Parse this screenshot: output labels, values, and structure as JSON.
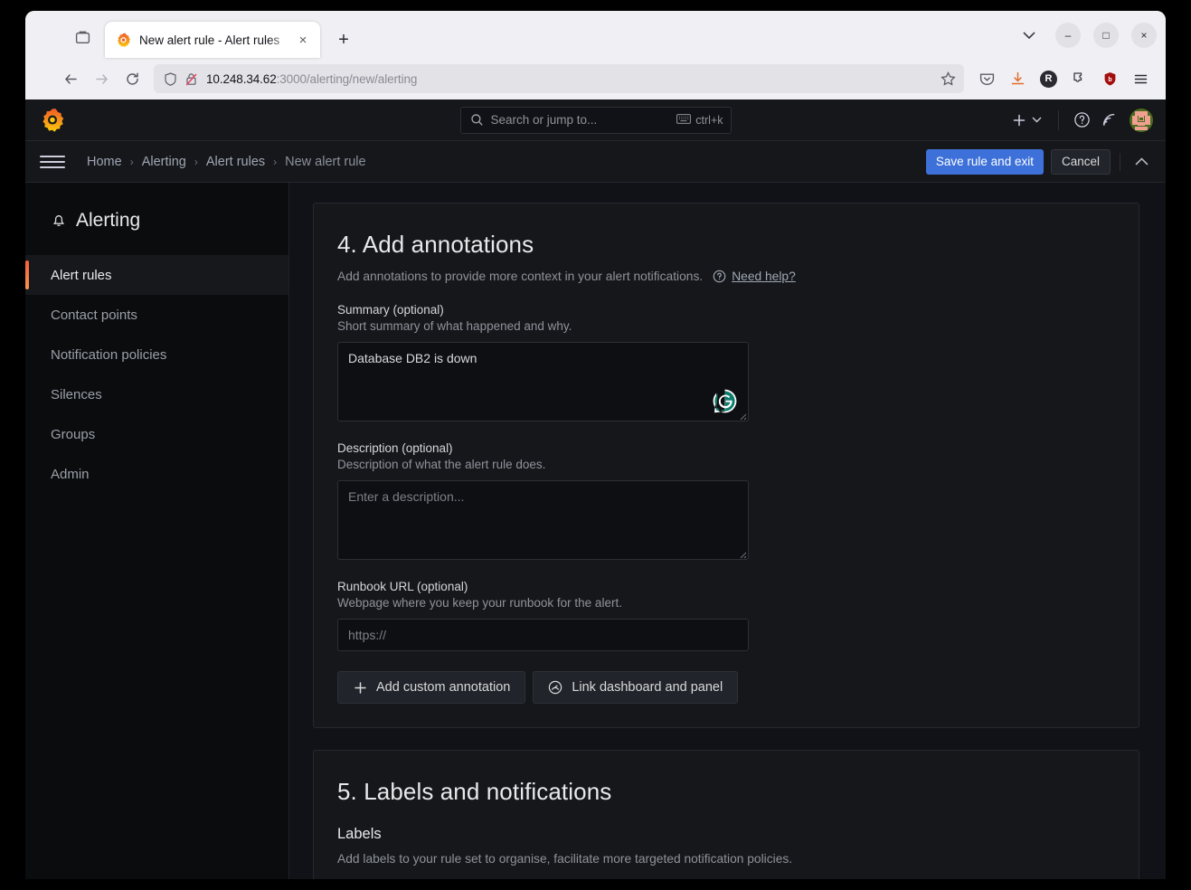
{
  "browser": {
    "tab": {
      "title": "New alert rule - Alert rules",
      "favicon": "grafana-icon",
      "close": "×"
    },
    "new_tab_label": "+",
    "url": {
      "host": "10.248.34.62",
      "rest": ":3000/alerting/new/alerting"
    },
    "toolbar_icons": [
      "pocket-icon",
      "download-icon",
      "account-avatar-icon",
      "extensions-icon",
      "ublock-shield-icon",
      "app-menu-icon"
    ],
    "window_controls": {
      "minimize": "–",
      "maximize": "□",
      "close": "×"
    }
  },
  "topnav": {
    "search": {
      "placeholder": "Search or jump to...",
      "shortcut": "ctrl+k"
    },
    "plus_label": "+",
    "icons": [
      "help-circle-icon",
      "news-feed-icon",
      "user-avatar"
    ]
  },
  "breadcrumb": {
    "items": [
      {
        "label": "Home",
        "current": false
      },
      {
        "label": "Alerting",
        "current": false
      },
      {
        "label": "Alert rules",
        "current": false
      },
      {
        "label": "New alert rule",
        "current": true
      }
    ],
    "separator": "›",
    "save_label": "Save rule and exit",
    "cancel_label": "Cancel"
  },
  "sidebar": {
    "title": "Alerting",
    "items": [
      {
        "label": "Alert rules",
        "active": true
      },
      {
        "label": "Contact points",
        "active": false
      },
      {
        "label": "Notification policies",
        "active": false
      },
      {
        "label": "Silences",
        "active": false
      },
      {
        "label": "Groups",
        "active": false
      },
      {
        "label": "Admin",
        "active": false
      }
    ]
  },
  "section4": {
    "heading": "4. Add annotations",
    "description": "Add annotations to provide more context in your alert notifications.",
    "need_help": "Need help?",
    "summary": {
      "label": "Summary (optional)",
      "sub": "Short summary of what happened and why.",
      "value": "Database DB2 is down"
    },
    "description_field": {
      "label": "Description (optional)",
      "sub": "Description of what the alert rule does.",
      "placeholder": "Enter a description...",
      "value": ""
    },
    "runbook": {
      "label": "Runbook URL (optional)",
      "sub": "Webpage where you keep your runbook for the alert.",
      "placeholder": "https://",
      "value": ""
    },
    "add_annotation_label": "Add custom annotation",
    "link_dashboard_label": "Link dashboard and panel"
  },
  "section5": {
    "heading": "5. Labels and notifications",
    "labels_heading": "Labels",
    "cut_text": "Add labels to your rule set to organise, facilitate more targeted notification policies."
  },
  "colors": {
    "accent_orange": "#f55f3e",
    "primary_blue": "#3d71d9",
    "page_bg": "#111217",
    "panel_bg": "#16171b",
    "sidebar_bg": "#0b0c0e",
    "grammarly_teal": "#0d7d6d"
  }
}
